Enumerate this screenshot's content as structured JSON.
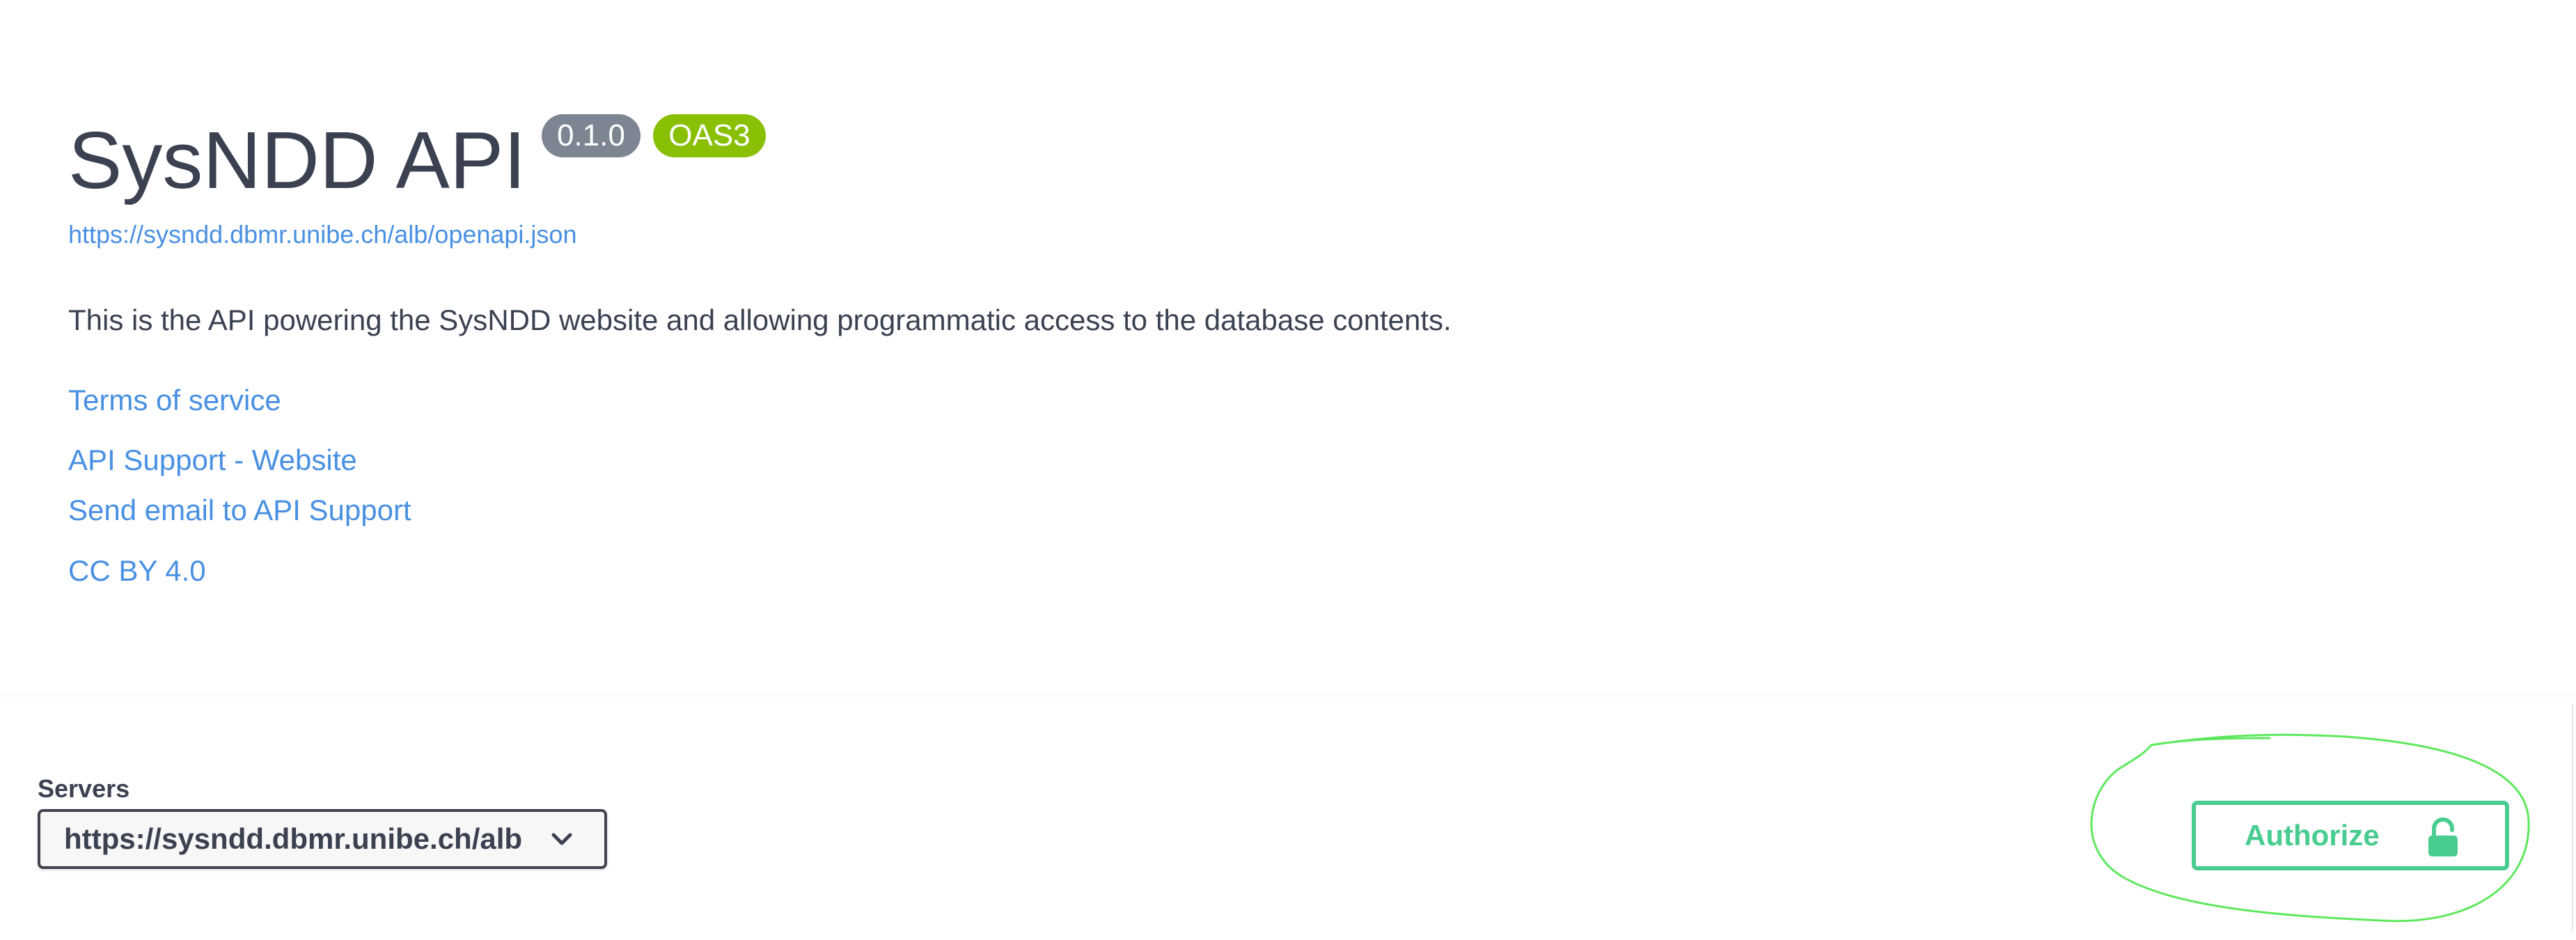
{
  "info": {
    "title": "SysNDD API",
    "version_badge": "0.1.0",
    "oas_badge": "OAS3",
    "spec_url": "https://sysndd.dbmr.unibe.ch/alb/openapi.json",
    "description": "This is the API powering the SysNDD website and allowing programmatic access to the database contents.",
    "links": {
      "terms": "Terms of service",
      "website": "API Support - Website",
      "email": "Send email to API Support",
      "license": "CC BY 4.0"
    }
  },
  "servers": {
    "label": "Servers",
    "selected": "https://sysndd.dbmr.unibe.ch/alb"
  },
  "authorize": {
    "label": "Authorize"
  },
  "icons": {
    "select_chevron": "chevron-down-icon",
    "authorize": "unlocked-lock-icon"
  },
  "colors": {
    "title_text": "#3b4151",
    "link": "#4990e2",
    "version_badge_bg": "#7d8492",
    "oas_badge_bg": "#89bf04",
    "authorize_green": "#49cc90",
    "annotation_circle": "#5ee85e"
  }
}
